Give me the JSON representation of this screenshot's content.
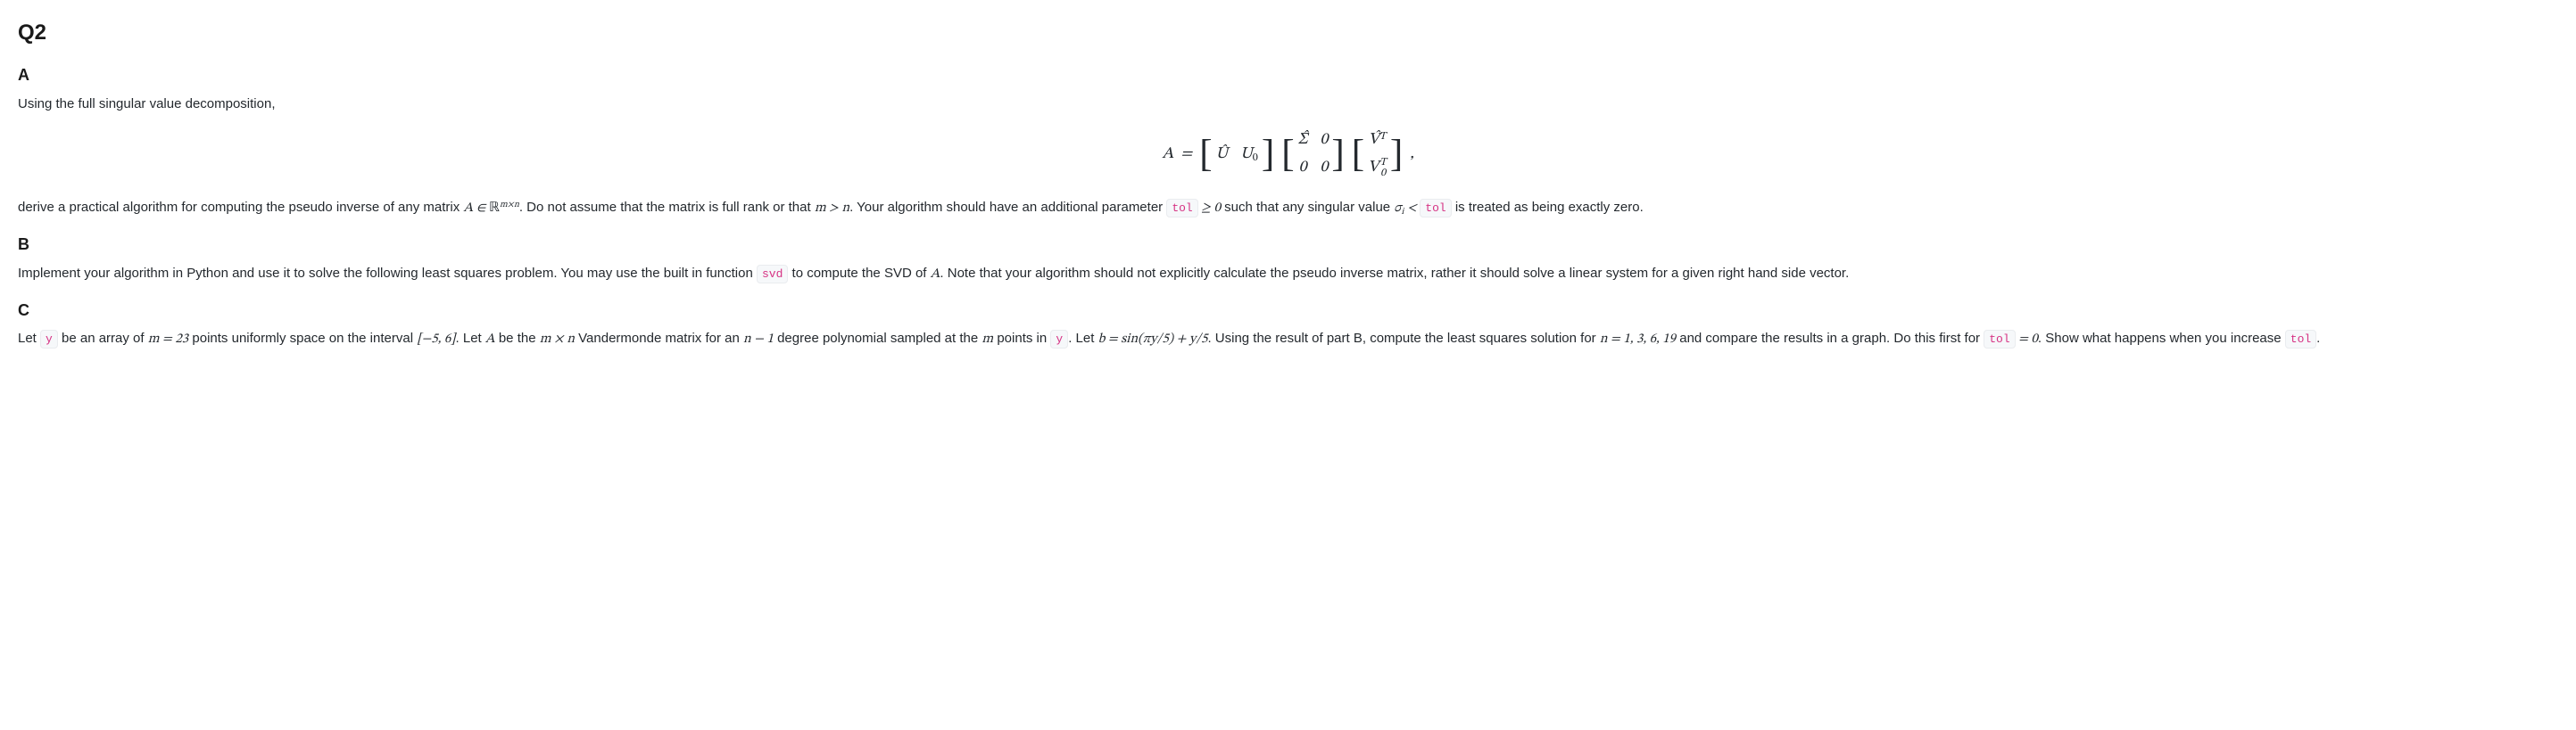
{
  "header": {
    "title": "Q2"
  },
  "partA": {
    "label": "A",
    "intro": "Using the full singular value decomposition,",
    "eq": {
      "lhs": "A",
      "eq_sym": " = ",
      "m1": {
        "c00": "Û",
        "c01": "U",
        "c01_sub": "0"
      },
      "m2": {
        "c00": "Σ̂",
        "c01": "0",
        "c10": "0",
        "c11": "0"
      },
      "m3": {
        "r0_base": "V̂",
        "r0_sup": "T",
        "r1_base": "V",
        "r1_sub": "0",
        "r1_sup": "T"
      },
      "trail": ","
    },
    "body_pre": "derive a practical algorithm for computing the pseudo inverse of any matrix ",
    "body_mat": "A ∈ ",
    "body_R": "ℝ",
    "body_R_sup": "m×n",
    "body_mid1": ". Do not assume that the matrix is full rank or that ",
    "body_mgn": "m > n",
    "body_mid2": ". Your algorithm should have an additional parameter ",
    "tol_code": "tol",
    "body_geq": " ≥ 0",
    "body_mid3": " such that any singular value ",
    "sigma": "σ",
    "sigma_sub": "i",
    "body_lt": " < ",
    "tol_code2": "tol",
    "body_end": " is treated as being exactly zero."
  },
  "partB": {
    "label": "B",
    "pre": "Implement your algorithm in Python and use it to solve the following least squares problem. You may use the built in function ",
    "svd_code": "svd",
    "mid": " to compute the SVD of ",
    "A": "A",
    "post": ". Note that your algorithm should not explicitly calculate the pseudo inverse matrix, rather it should solve a linear system for a given right hand side vector."
  },
  "partC": {
    "label": "C",
    "s1": "Let ",
    "y_code": "y",
    "s2": " be an array of ",
    "m23": "m = 23",
    "s3": " points uniformly space on the interval ",
    "interval": "[−5, 6]",
    "s4": ". Let ",
    "A": "A",
    "s5": " be the ",
    "mxn": "m × n",
    "s6": " Vandermonde matrix for an ",
    "nminus1": "n − 1",
    "s7": " degree polynomial sampled at the ",
    "m_var": "m",
    "s8": " points in ",
    "y_code2": "y",
    "s9": ". Let ",
    "beq": "b = sin(πy/5) + y/5",
    "s10": ". Using the result of part B, compute the least squares solution for ",
    "nvals": "n = 1, 3, 6, 19",
    "s11": " and compare the results in a graph. Do this first for ",
    "tol_code": "tol",
    "tol_eq0": " = 0",
    "s12": ". Show what happens when you increase ",
    "tol_code2": "tol",
    "s13": "."
  }
}
